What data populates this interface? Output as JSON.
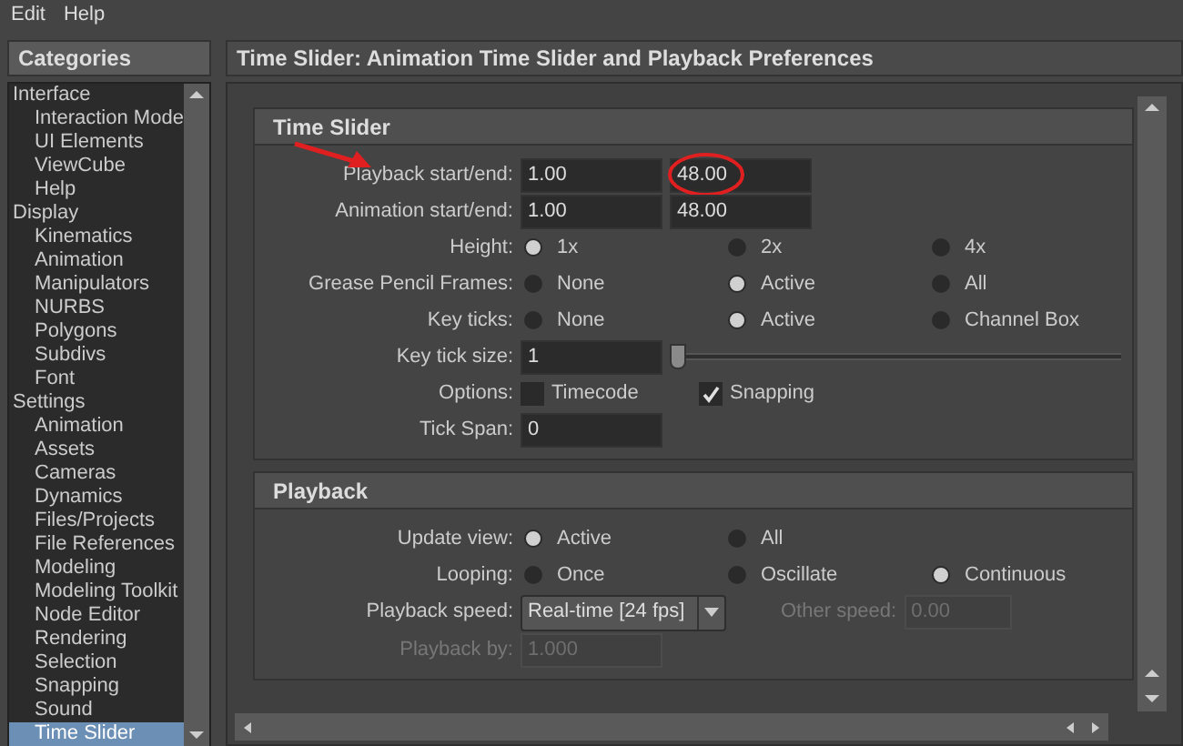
{
  "menu": [
    "Edit",
    "Help"
  ],
  "categories": {
    "title": "Categories",
    "items": [
      {
        "label": "Interface",
        "selected": false,
        "children": [
          {
            "label": "Interaction Mode",
            "selected": false
          },
          {
            "label": "UI Elements",
            "selected": false
          },
          {
            "label": "ViewCube",
            "selected": false
          },
          {
            "label": "Help",
            "selected": false
          }
        ]
      },
      {
        "label": "Display",
        "selected": false,
        "children": [
          {
            "label": "Kinematics",
            "selected": false
          },
          {
            "label": "Animation",
            "selected": false
          },
          {
            "label": "Manipulators",
            "selected": false
          },
          {
            "label": "NURBS",
            "selected": false
          },
          {
            "label": "Polygons",
            "selected": false
          },
          {
            "label": "Subdivs",
            "selected": false
          },
          {
            "label": "Font",
            "selected": false
          }
        ]
      },
      {
        "label": "Settings",
        "selected": false,
        "children": [
          {
            "label": "Animation",
            "selected": false
          },
          {
            "label": "Assets",
            "selected": false
          },
          {
            "label": "Cameras",
            "selected": false
          },
          {
            "label": "Dynamics",
            "selected": false
          },
          {
            "label": "Files/Projects",
            "selected": false
          },
          {
            "label": "File References",
            "selected": false
          },
          {
            "label": "Modeling",
            "selected": false
          },
          {
            "label": "Modeling Toolkit",
            "selected": false
          },
          {
            "label": "Node Editor",
            "selected": false
          },
          {
            "label": "Rendering",
            "selected": false
          },
          {
            "label": "Selection",
            "selected": false
          },
          {
            "label": "Snapping",
            "selected": false
          },
          {
            "label": "Sound",
            "selected": false
          },
          {
            "label": "Time Slider",
            "selected": true
          }
        ]
      }
    ]
  },
  "panel": {
    "title": "Time Slider: Animation Time Slider and Playback Preferences",
    "sections": [
      {
        "title": "Time Slider",
        "rows": [
          {
            "kind": "pair",
            "label": "Playback start/end:",
            "values": [
              "1.00",
              "48.00"
            ],
            "annotated": true
          },
          {
            "kind": "pair",
            "label": "Animation start/end:",
            "values": [
              "1.00",
              "48.00"
            ],
            "annotated": false
          },
          {
            "kind": "radio",
            "label": "Height:",
            "options": [
              {
                "label": "1x",
                "selected": true
              },
              {
                "label": "2x",
                "selected": false
              },
              {
                "label": "4x",
                "selected": false
              }
            ]
          },
          {
            "kind": "radio",
            "label": "Grease Pencil Frames:",
            "options": [
              {
                "label": "None",
                "selected": false
              },
              {
                "label": "Active",
                "selected": true
              },
              {
                "label": "All",
                "selected": false
              }
            ]
          },
          {
            "kind": "radio",
            "label": "Key ticks:",
            "options": [
              {
                "label": "None",
                "selected": false
              },
              {
                "label": "Active",
                "selected": true
              },
              {
                "label": "Channel Box",
                "selected": false
              }
            ]
          },
          {
            "kind": "slider",
            "label": "Key tick size:",
            "value": "1",
            "level": 0
          },
          {
            "kind": "checks",
            "label": "Options:",
            "options": [
              {
                "label": "Timecode",
                "checked": false
              },
              {
                "label": "Snapping",
                "checked": true
              }
            ]
          },
          {
            "kind": "field",
            "label": "Tick Span:",
            "value": "0",
            "disabled": false
          }
        ]
      },
      {
        "title": "Playback",
        "rows": [
          {
            "kind": "radio",
            "label": "Update view:",
            "options": [
              {
                "label": "Active",
                "selected": true
              },
              {
                "label": "All",
                "selected": false
              }
            ]
          },
          {
            "kind": "radio",
            "label": "Looping:",
            "options": [
              {
                "label": "Once",
                "selected": false
              },
              {
                "label": "Oscillate",
                "selected": false
              },
              {
                "label": "Continuous",
                "selected": true
              }
            ]
          },
          {
            "kind": "dropdown",
            "label": "Playback speed:",
            "value": "Real-time [24 fps]",
            "extra": {
              "label": "Other speed:",
              "value": "0.00",
              "disabled": true
            }
          },
          {
            "kind": "field",
            "label": "Playback by:",
            "value": "1.000",
            "disabled": true
          }
        ]
      }
    ]
  }
}
